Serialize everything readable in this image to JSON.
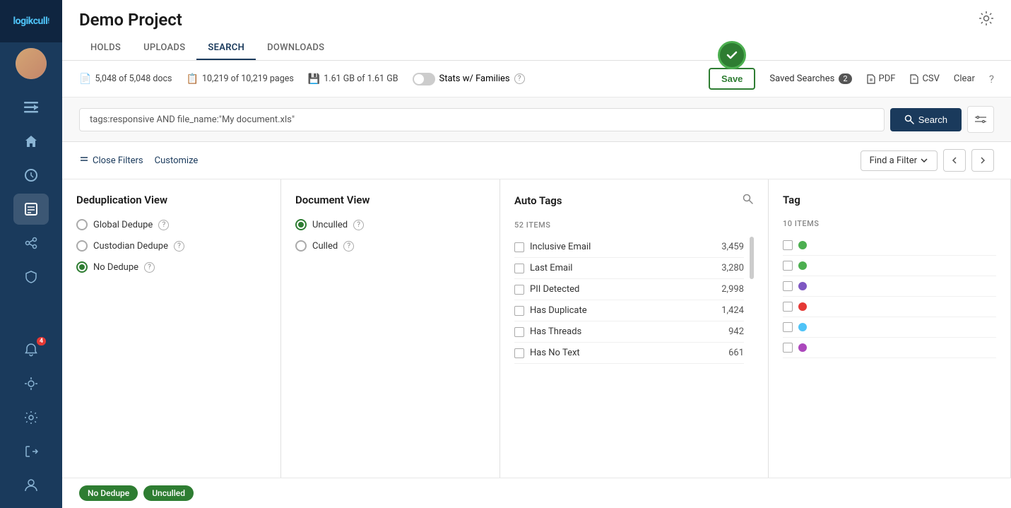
{
  "app": {
    "logo": "logikcull"
  },
  "header": {
    "title": "Demo Project",
    "nav_tabs": [
      "HOLDS",
      "UPLOADS",
      "SEARCH",
      "DOWNLOADS"
    ],
    "active_tab": "SEARCH"
  },
  "stats": {
    "docs": "5,048 of 5,048 docs",
    "pages": "10,219 of 10,219 pages",
    "storage": "1.61 GB of 1.61 GB",
    "stats_label": "Stats w/ Families",
    "save_label": "Save",
    "saved_searches_label": "Saved Searches",
    "saved_searches_count": "2",
    "pdf_label": "PDF",
    "csv_label": "CSV",
    "clear_label": "Clear"
  },
  "search": {
    "query": "tags:responsive AND file_name:\"My document.xls\"",
    "button_label": "Search"
  },
  "filters": {
    "close_label": "Close Filters",
    "customize_label": "Customize",
    "find_filter_label": "Find a Filter"
  },
  "dedup_view": {
    "title": "Deduplication View",
    "options": [
      {
        "label": "Global Dedupe",
        "checked": false
      },
      {
        "label": "Custodian Dedupe",
        "checked": false
      },
      {
        "label": "No Dedupe",
        "checked": true
      }
    ]
  },
  "document_view": {
    "title": "Document View",
    "options": [
      {
        "label": "Unculled",
        "checked": true
      },
      {
        "label": "Culled",
        "checked": false
      }
    ]
  },
  "auto_tags": {
    "title": "Auto Tags",
    "items_count": "52 ITEMS",
    "items": [
      {
        "label": "Inclusive Email",
        "count": "3,459"
      },
      {
        "label": "Last Email",
        "count": "3,280"
      },
      {
        "label": "PII Detected",
        "count": "2,998"
      },
      {
        "label": "Has Duplicate",
        "count": "1,424"
      },
      {
        "label": "Has Threads",
        "count": "942"
      },
      {
        "label": "Has No Text",
        "count": "661"
      }
    ]
  },
  "tags_col": {
    "title": "Tag",
    "items_count": "10 ITEMS",
    "dot_colors": [
      "#4caf50",
      "#4caf50",
      "#7e57c2",
      "#e53935",
      "#4fc3f7",
      "#ab47bc"
    ]
  },
  "active_filters": [
    {
      "label": "No Dedupe",
      "color": "green"
    },
    {
      "label": "Unculled",
      "color": "green"
    }
  ],
  "sidebar": {
    "items": [
      {
        "icon": "≡→",
        "name": "collapse-icon"
      },
      {
        "icon": "⌂",
        "name": "home-icon"
      },
      {
        "icon": "⚡",
        "name": "processing-icon"
      },
      {
        "icon": "📋",
        "name": "review-icon",
        "active": true
      },
      {
        "icon": "⊕",
        "name": "share-icon"
      },
      {
        "icon": "🛡",
        "name": "shield-icon"
      }
    ],
    "bottom_items": [
      {
        "icon": "🔔",
        "name": "notification-icon",
        "badge": "4"
      },
      {
        "icon": "☀",
        "name": "theme-icon"
      },
      {
        "icon": "⚙",
        "name": "settings-icon"
      },
      {
        "icon": "⏻",
        "name": "logout-icon"
      },
      {
        "icon": "👤",
        "name": "profile-icon"
      }
    ]
  }
}
